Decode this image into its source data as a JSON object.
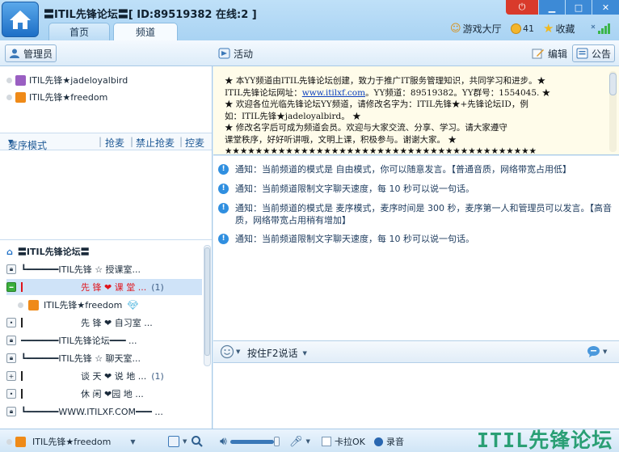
{
  "window": {
    "title": "〓ITIL先锋论坛〓[ ID:89519382 在线:2 ]",
    "tabs": [
      "首页",
      "频道"
    ],
    "game_hall": "游戏大厅",
    "coins": "41",
    "favorites": "收藏"
  },
  "toolbar": {
    "admin_label": "管理员",
    "activity_label": "活动",
    "edit_label": "编辑",
    "notice_label": "公告"
  },
  "admins": [
    {
      "name": "ITIL先锋★jadeloyalbird"
    },
    {
      "name": "ITIL先锋★freedom"
    }
  ],
  "mic_controls": {
    "mode": "麦序模式",
    "grab": "抢麦",
    "forbid_grab": "禁止抢麦",
    "control": "控麦"
  },
  "channel_tree": {
    "root": "〓ITIL先锋论坛〓",
    "rows": [
      {
        "name": "┗━━━━━━ITIL先锋 ☆ 授课室...",
        "count": ""
      },
      {
        "name": "先 锋 ❤ 课 堂 ...",
        "count": "(1)"
      },
      {
        "name": "ITIL先锋★freedom",
        "count": ""
      },
      {
        "name": "先 锋 ❤ 自习室 ...",
        "count": ""
      },
      {
        "name": "━━━━━━━ITIL先锋论坛━━━ ...",
        "count": ""
      },
      {
        "name": "┗━━━━━━ITIL先锋 ☆ 聊天室...",
        "count": ""
      },
      {
        "name": "谈 天 ❤ 说 地 ...",
        "count": "(1)"
      },
      {
        "name": "休 闲 ❤园 地 ...",
        "count": ""
      },
      {
        "name": "┗━━━━━━WWW.ITILXF.COM━━━ ...",
        "count": ""
      }
    ]
  },
  "notice_board": {
    "line1": "★      本YY频道由ITIL先锋论坛创建，致力于推广IT服务管理知识，共同学习和进步。★",
    "line2_prefix": "ITIL先锋论坛网址：",
    "line2_link": "www.itilxf.com",
    "line2_suffix": "。YY频道：89519382。YY群号：1554045.     ★",
    "line3": "★              欢迎各位光临先锋论坛YY频道，请修改名字为：ITIL先锋★+先锋论坛ID，例",
    "line4": "如：ITIL先锋★jadeloyalbird。                                               ★",
    "line5": "★                  修改名字后可成为频道会员。欢迎与大家交流、分享、学习。请大家遵守",
    "line6": "课堂秩序，好好听讲哦，文明上课，积极参与。谢谢大家。                          ★",
    "line7": "★★★★★★★★★★★★★★★★★★★★★★★★★★★★★★★★★★★★★★★★★"
  },
  "messages": [
    {
      "text": "通知：当前频道的模式是 自由模式，你可以随意发言。【普通音质，网络带宽占用低】"
    },
    {
      "text": "通知：当前频道限制文字聊天速度，每 10 秒可以说一句话。"
    },
    {
      "text": "通知：当前频道的模式是 麦序模式，麦序时间是 300 秒，麦序第一人和管理员可以发言。【高音质，网络带宽占用稍有增加】"
    },
    {
      "text": "通知：当前频道限制文字聊天速度，每 10 秒可以说一句话。"
    }
  ],
  "input": {
    "press_f2": "按住F2说话"
  },
  "bottom": {
    "user_name": "ITIL先锋★freedom",
    "karaoke": "卡拉OK",
    "recording": "录音"
  },
  "watermark": "ITIL先锋论坛",
  "colors": {
    "accent": "#1d6fc6",
    "red_channel": "#e0141c",
    "watermark": "#2a9f74",
    "notice_bg": "#fffcea"
  }
}
